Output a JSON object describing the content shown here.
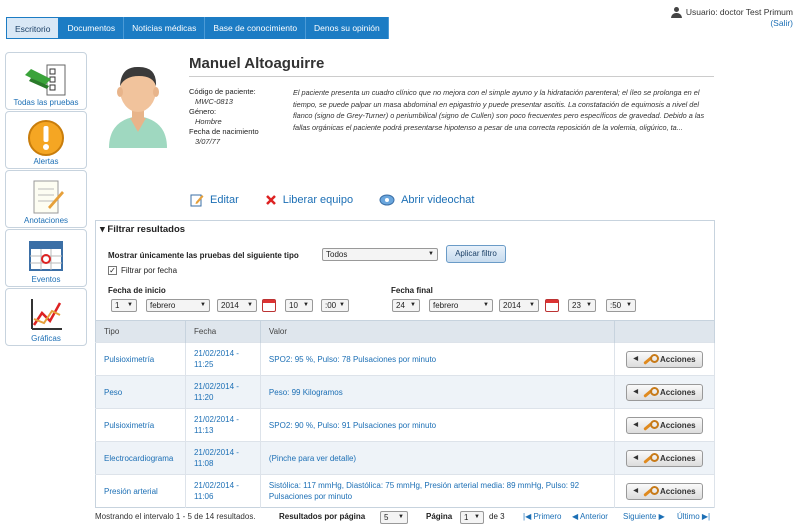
{
  "nav": {
    "tabs": [
      "Escritorio",
      "Documentos",
      "Noticias médicas",
      "Base de conocimiento",
      "Denos su opinión"
    ],
    "active_index": 0
  },
  "user": {
    "label": "Usuario: doctor Test Primum",
    "logout": "(Salir)"
  },
  "sidebar": {
    "items": [
      {
        "label": "Todas las pruebas",
        "icon": "checklist-icon"
      },
      {
        "label": "Alertas",
        "icon": "alert-icon"
      },
      {
        "label": "Anotaciones",
        "icon": "notepad-icon"
      },
      {
        "label": "Eventos",
        "icon": "calendar-icon"
      },
      {
        "label": "Gráficas",
        "icon": "chart-icon"
      }
    ]
  },
  "patient": {
    "name": "Manuel Altoaguirre",
    "code_label": "Código de paciente:",
    "code_value": "MWC-0813",
    "gender_label": "Género:",
    "gender_value": "Hombre",
    "birth_label": "Fecha de nacimiento",
    "birth_value": "3/07/77",
    "description": "El paciente presenta un cuadro clínico que no mejora con el simple ayuno y la hidratación parenteral; el íleo se prolonga en el tiempo, se puede palpar un masa abdominal en epigastrio y puede presentar ascitis. La constatación de equimosis a nivel del flanco (signo de Grey-Turner) o periumbilical (signo de Cullen) son poco frecuentes pero específicos de gravedad. Debido a las fallas orgánicas el paciente podrá presentarse hipotenso a pesar de una correcta reposición de la volemia, oligúrico, ta..."
  },
  "actions": {
    "edit": "Editar",
    "release": "Liberar equipo",
    "videochat": "Abrir videochat"
  },
  "filter": {
    "title": "Filtrar resultados",
    "type_label": "Mostrar únicamente las pruebas del siguiente tipo",
    "type_value": "Todos",
    "apply": "Aplicar filtro",
    "by_date_label": "Filtrar por fecha",
    "by_date_checked": "✓",
    "start_label": "Fecha de inicio",
    "start": {
      "day": "1",
      "month": "febrero",
      "year": "2014",
      "hour": "10",
      "min": ":00"
    },
    "end_label": "Fecha final",
    "end": {
      "day": "24",
      "month": "febrero",
      "year": "2014",
      "hour": "23",
      "min": ":50"
    }
  },
  "table": {
    "headers": [
      "Tipo",
      "Fecha",
      "Valor",
      ""
    ],
    "action_label": "Acciones",
    "rows": [
      {
        "tipo": "Pulsioximetría",
        "fecha": "21/02/2014 - 11:25",
        "valor": "SPO2: 95 %, Pulso: 78 Pulsaciones por minuto"
      },
      {
        "tipo": "Peso",
        "fecha": "21/02/2014 - 11:20",
        "valor": "Peso: 99 Kilogramos"
      },
      {
        "tipo": "Pulsioximetría",
        "fecha": "21/02/2014 - 11:13",
        "valor": "SPO2: 90 %, Pulso: 91 Pulsaciones por minuto"
      },
      {
        "tipo": "Electrocardiograma",
        "fecha": "21/02/2014 - 11:08",
        "valor": "(Pinche para ver detalle)"
      },
      {
        "tipo": "Presión arterial",
        "fecha": "21/02/2014 - 11:06",
        "valor": "Sistólica: 117 mmHg, Diastólica: 75 mmHg, Presión arterial media: 89 mmHg, Pulso: 92 Pulsaciones por minuto"
      }
    ]
  },
  "pager": {
    "info": "Mostrando el intervalo 1 - 5 de 14 resultados.",
    "per_page_label": "Resultados por página",
    "per_page_value": "5",
    "page_label": "Página",
    "page_value": "1",
    "page_of": "de 3",
    "first": "Primero",
    "prev": "Anterior",
    "next": "Siguiente",
    "last": "Último"
  },
  "colors": {
    "accent": "#1c7cc4",
    "link": "#1c6fb5",
    "header_bg": "#dfe6ed",
    "alt_row": "#eef3f8"
  }
}
